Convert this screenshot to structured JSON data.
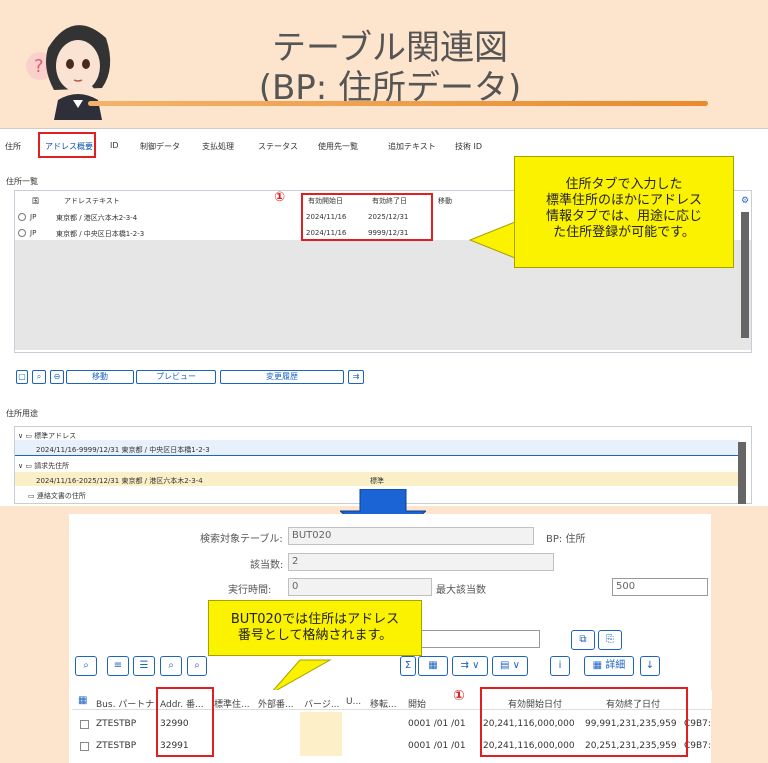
{
  "header": {
    "title_line1": "テーブル関連図",
    "title_line2": "(BP: 住所データ)"
  },
  "sap_top": {
    "tabs": [
      "住所",
      "アドレス概要",
      "ID",
      "制御データ",
      "支払処理",
      "ステータス",
      "使用先一覧",
      "追加テキスト",
      "技術 ID"
    ],
    "section_address_list": "住所一覧",
    "grid_columns": {
      "country": "国",
      "address_text": "アドレステキスト",
      "valid_from": "有効開始日",
      "valid_to": "有効終了日",
      "move": "移動"
    },
    "rows": [
      {
        "country": "JP",
        "address": "東京都 / 港区六本木2-3-4",
        "from": "2024/11/16",
        "to": "2025/12/31"
      },
      {
        "country": "JP",
        "address": "東京都 / 中央区日本橋1-2-3",
        "from": "2024/11/16",
        "to": "9999/12/31"
      }
    ],
    "marker": "①",
    "buttons": {
      "move": "移動",
      "preview": "プレビュー",
      "change_history": "変更履歴"
    },
    "section_usage": "住所用途",
    "tree": {
      "std_address": "標準アドレス",
      "std_entry": "2024/11/16-9999/12/31   東京都 / 中央区日本橋1-2-3",
      "billing": "請求先住所",
      "billing_entry": "2024/11/16-2025/12/31   東京都 / 港区六本木2-3-4",
      "billing_flag": "標準",
      "contact_doc": "連絡文書の住所"
    }
  },
  "callout_top": "住所タブで入力した\n標準住所のほかにアドレス\n情報タブでは、用途に応じ\nた住所登録が可能です。",
  "callout_bottom": "BUT020では住所はアドレス\n番号として格納されます。",
  "se16": {
    "label_table": "検索対象テーブル:",
    "table_value": "BUT020",
    "table_desc": "BP: 住所",
    "label_hits": "該当数:",
    "hits_value": "2",
    "label_runtime": "実行時間:",
    "runtime_value": "0",
    "label_max": "最大該当数",
    "max_value": "500",
    "detail_button": "詳細",
    "marker": "①",
    "columns": [
      "Bus. パートナ",
      "Addr. 番...",
      "標準住...",
      "外部番...",
      "バージ...",
      "U...",
      "移転...",
      "開始",
      "有効開始日付",
      "有効終了日付"
    ],
    "rows": [
      {
        "partner": "ZTESTBP",
        "addr": "32990",
        "start": "0001 /01 /01",
        "from": "20,241,116,000,000",
        "to": "99,991,231,235,959",
        "extra": "C9B7:"
      },
      {
        "partner": "ZTESTBP",
        "addr": "32991",
        "start": "0001 /01 /01",
        "from": "20,241,116,000,000",
        "to": "20,251,231,235,959",
        "extra": "C9B7:"
      }
    ]
  },
  "colors": {
    "accent": "#0a4cb5",
    "highlight": "#e02020",
    "callout": "#fbf200",
    "background": "#fde4cc"
  }
}
